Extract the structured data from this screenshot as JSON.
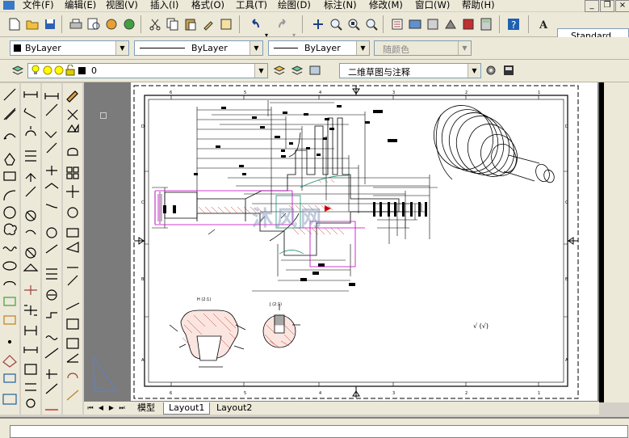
{
  "menu": {
    "items": [
      "文件(F)",
      "编辑(E)",
      "视图(V)",
      "插入(I)",
      "格式(O)",
      "工具(T)",
      "绘图(D)",
      "标注(N)",
      "修改(M)",
      "窗口(W)",
      "帮助(H)"
    ]
  },
  "toolbar": {
    "text_style": "Standard"
  },
  "properties": {
    "color": "ByLayer",
    "linetype": "ByLayer",
    "lineweight": "ByLayer",
    "plot_style": "随颜色"
  },
  "layers": {
    "current_layer": "0",
    "workspace": "二维草图与注释"
  },
  "drawing": {
    "section_h_label": "H (2:1)",
    "section_j_label": "J (2:1)",
    "roughness_note": "√ (√)",
    "border_numbers_top": [
      "6",
      "5",
      "4",
      "3",
      "2",
      "1"
    ],
    "border_letters_left": [
      "D",
      "C",
      "B",
      "A"
    ],
    "watermark": "沐风网"
  },
  "tabs": {
    "model": "模型",
    "layout1": "Layout1",
    "layout2": "Layout2"
  },
  "colors": {
    "background": "#d4d0c8",
    "toolbar": "#ece9d8",
    "canvas_gray": "#7b7b7b",
    "hatch_red": "#c0392b",
    "magenta": "#c000c0",
    "teal": "#008080"
  }
}
